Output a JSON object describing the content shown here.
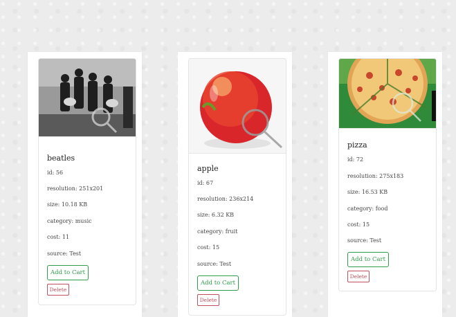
{
  "cards": [
    {
      "title": "beatles",
      "fields": [
        "id: 56",
        "resolution: 251x201",
        "size: 10.18 KB",
        "category: music",
        "cost: 11",
        "source: Test"
      ],
      "add_label": "Add to Cart",
      "delete_label": "Delete",
      "image_icon": "photo-band-icon"
    },
    {
      "title": "apple",
      "fields": [
        "id: 67",
        "resolution: 236x214",
        "size: 6.32 KB",
        "category: fruit",
        "cost: 15",
        "source: Test"
      ],
      "add_label": "Add to Cart",
      "delete_label": "Delete",
      "image_icon": "photo-apple-icon"
    },
    {
      "title": "pizza",
      "fields": [
        "id: 72",
        "resolution: 275x183",
        "size: 16.53 KB",
        "category: food",
        "cost: 15",
        "source: Test"
      ],
      "add_label": "Add to Cart",
      "delete_label": "Delete",
      "image_icon": "photo-pizza-icon"
    }
  ],
  "colors": {
    "add": "#2e9b4a",
    "delete": "#c0505e",
    "background": "#ececec"
  }
}
